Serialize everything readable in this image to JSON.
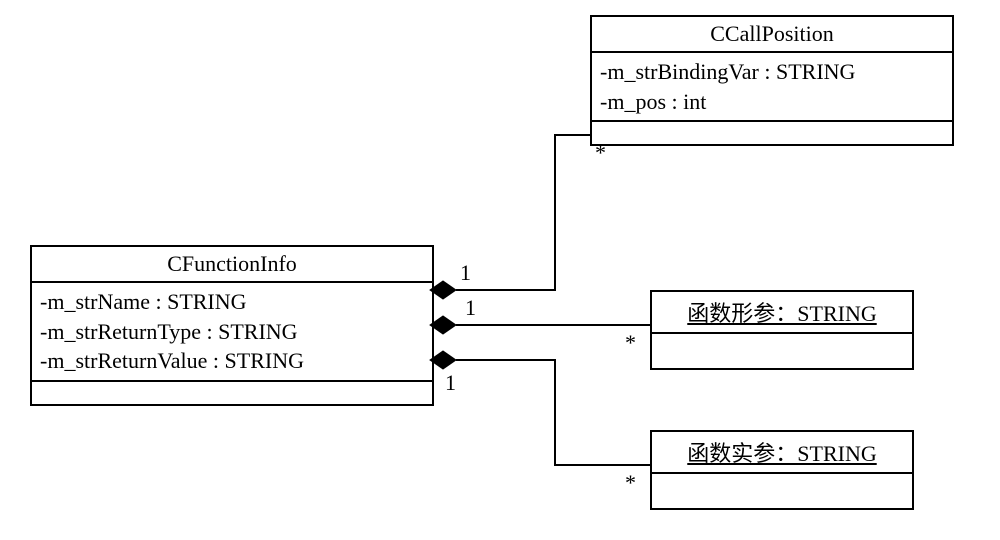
{
  "classes": {
    "cFunctionInfo": {
      "name": "CFunctionInfo",
      "attrs": [
        "-m_strName : STRING",
        "-m_strReturnType : STRING",
        "-m_strReturnValue : STRING"
      ]
    },
    "cCallPosition": {
      "name": "CCallPosition",
      "attrs": [
        "-m_strBindingVar : STRING",
        "-m_pos : int"
      ]
    },
    "param": {
      "title": "函数形参：STRING"
    },
    "arg": {
      "title": "函数实参：STRING"
    }
  },
  "multiplicities": {
    "cfun_to_call_src": "1",
    "cfun_to_call_dst": "*",
    "cfun_to_param_src": "1",
    "cfun_to_param_dst": "*",
    "cfun_to_arg_src": "1",
    "cfun_to_arg_dst": "*"
  },
  "chart_data": {
    "type": "diagram",
    "nodes": [
      {
        "id": "CFunctionInfo",
        "kind": "class",
        "attributes": [
          {
            "name": "m_strName",
            "type": "STRING",
            "visibility": "-"
          },
          {
            "name": "m_strReturnType",
            "type": "STRING",
            "visibility": "-"
          },
          {
            "name": "m_strReturnValue",
            "type": "STRING",
            "visibility": "-"
          }
        ]
      },
      {
        "id": "CCallPosition",
        "kind": "class",
        "attributes": [
          {
            "name": "m_strBindingVar",
            "type": "STRING",
            "visibility": "-"
          },
          {
            "name": "m_pos",
            "type": "int",
            "visibility": "-"
          }
        ]
      },
      {
        "id": "函数形参",
        "kind": "object",
        "type": "STRING"
      },
      {
        "id": "函数实参",
        "kind": "object",
        "type": "STRING"
      }
    ],
    "edges": [
      {
        "from": "CFunctionInfo",
        "to": "CCallPosition",
        "kind": "composition",
        "from_mult": "1",
        "to_mult": "*"
      },
      {
        "from": "CFunctionInfo",
        "to": "函数形参",
        "kind": "composition",
        "from_mult": "1",
        "to_mult": "*"
      },
      {
        "from": "CFunctionInfo",
        "to": "函数实参",
        "kind": "composition",
        "from_mult": "1",
        "to_mult": "*"
      }
    ]
  }
}
